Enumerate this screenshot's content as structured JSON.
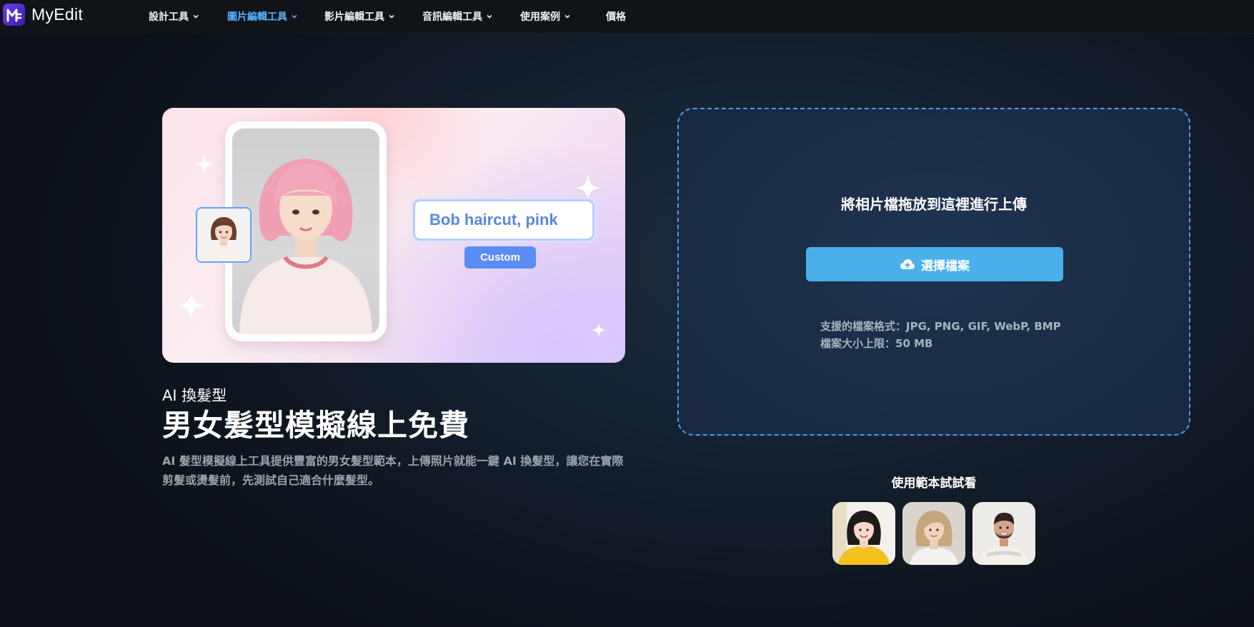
{
  "nav": {
    "brand": "MyEdit",
    "items": [
      {
        "label": "設計工具",
        "has_dropdown": true
      },
      {
        "label": "圖片編輯工具",
        "has_dropdown": true,
        "active": true
      },
      {
        "label": "影片編輯工具",
        "has_dropdown": true
      },
      {
        "label": "音訊編輯工具",
        "has_dropdown": true
      },
      {
        "label": "使用案例",
        "has_dropdown": true
      },
      {
        "label": "價格",
        "has_dropdown": false
      }
    ],
    "active_color": "#55b4ff"
  },
  "hero": {
    "prompt_text": "Bob haircut, pink",
    "custom_label": "Custom",
    "eyebrow": "AI 換髮型",
    "headline": "男女髮型模擬線上免費",
    "description": "AI 髮型模擬線上工具提供豐富的男女髮型範本，上傳照片就能一鍵 AI 換髮型，讓您在實際剪髮或燙髮前，先測試自己適合什麼髮型。"
  },
  "upload": {
    "title": "將相片檔拖放到這裡進行上傳",
    "button_label": "選擇檔案",
    "button_icon": "cloud-upload-icon",
    "formats_line": "支援的檔案格式：JPG, PNG, GIF, WebP, BMP",
    "size_line": "檔案大小上限：50 MB",
    "accent_color": "#4ab0ec"
  },
  "samples": {
    "title": "使用範本試試看",
    "items": [
      {
        "name": "sample-woman-yellow"
      },
      {
        "name": "sample-woman-blonde"
      },
      {
        "name": "sample-man-smiling"
      }
    ]
  }
}
